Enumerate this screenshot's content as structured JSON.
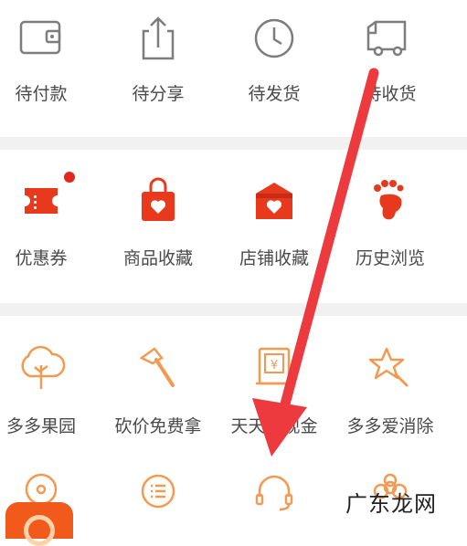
{
  "orders": {
    "items": [
      {
        "label": "待付款",
        "icon": "wallet-icon"
      },
      {
        "label": "待分享",
        "icon": "share-icon"
      },
      {
        "label": "待发货",
        "icon": "clock-icon"
      },
      {
        "label": "待收货",
        "icon": "truck-icon"
      }
    ]
  },
  "assets": {
    "items": [
      {
        "label": "优惠券",
        "icon": "coupon-icon"
      },
      {
        "label": "商品收藏",
        "icon": "goods-favorite-icon"
      },
      {
        "label": "店铺收藏",
        "icon": "store-favorite-icon"
      },
      {
        "label": "历史浏览",
        "icon": "footprint-icon"
      }
    ]
  },
  "services": {
    "items": [
      {
        "label": "多多果园",
        "icon": "tree-icon"
      },
      {
        "label": "砍价免费拿",
        "icon": "axe-icon"
      },
      {
        "label": "天天领现金",
        "icon": "cash-icon"
      },
      {
        "label": "多多爱消除",
        "icon": "star-icon"
      }
    ],
    "row2_icons": [
      "location-icon",
      "list-icon",
      "headset-icon",
      "flower-icon"
    ]
  },
  "watermark": {
    "text": "广东龙网"
  },
  "colors": {
    "accent": "#f25a1c",
    "icon_gray": "#7d7d7d",
    "outline_orange": "#f39a52",
    "arrow": "#ec3a3f"
  }
}
